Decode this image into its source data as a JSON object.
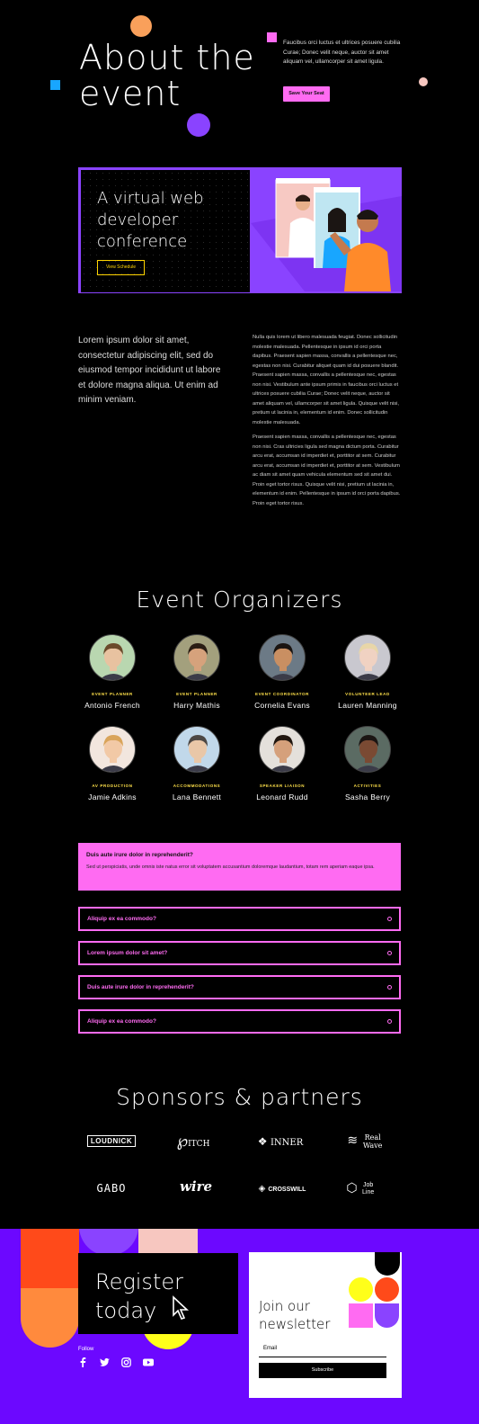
{
  "hero": {
    "title_line1": "About the",
    "title_line2": "event",
    "description": "Faucibus orci luctus et ultrices posuere cubilia Curae; Donec velit neque, auctor sit amet aliquam vel, ullamcorper sit amet ligula.",
    "cta": "Save Your Seat"
  },
  "banner": {
    "title": "A virtual web developer conference",
    "button": "View Schedule"
  },
  "intro": {
    "lead": "Lorem ipsum dolor sit amet, consectetur adipiscing elit, sed do eiusmod tempor incididunt ut labore et dolore magna aliqua. Ut enim ad minim veniam.",
    "para1": "Nulla quis lorem ut libero malesuada feugiat. Donec sollicitudin molestie malesuada. Pellentesque in ipsum id orci porta dapibus. Praesent sapien massa, convallis a pellentesque nec, egestas non nisi. Curabitur aliquet quam id dui posuere blandit. Praesent sapien massa, convallis a pellentesque nec, egestas non nisi. Vestibulum ante ipsum primis in faucibus orci luctus et ultrices posuere cubilia Curae; Donec velit neque, auctor sit amet aliquam vel, ullamcorper sit amet ligula. Quisque velit nisi, pretium ut lacinia in, elementum id enim. Donec sollicitudin molestie malesuada.",
    "para2": "Praesent sapien massa, convallis a pellentesque nec, egestas non nisi. Cras ultricies ligula sed magna dictum porta. Curabitur arcu erat, accumsan id imperdiet et, porttitor at sem. Curabitur arcu erat, accumsan id imperdiet et, porttitor at sem. Vestibulum ac diam sit amet quam vehicula elementum sed sit amet dui. Proin eget tortor risus. Quisque velit nisi, pretium ut lacinia in, elementum id enim. Pellentesque in ipsum id orci porta dapibus. Proin eget tortor risus."
  },
  "organizers": {
    "title": "Event Organizers",
    "people": [
      {
        "role": "EVENT PLANNER",
        "name": "Antonio French",
        "skin": "#e8c2a0",
        "hair": "#6b4a2b",
        "bg": "#b9d7b0"
      },
      {
        "role": "EVENT PLANNER",
        "name": "Harry Mathis",
        "skin": "#d6a27c",
        "hair": "#2a1d14",
        "bg": "#a3a07d"
      },
      {
        "role": "EVENT COORDINATOR",
        "name": "Cornelia Evans",
        "skin": "#c98f62",
        "hair": "#1a1411",
        "bg": "#6c7a86"
      },
      {
        "role": "VOLUNTEER LEAD",
        "name": "Lauren Manning",
        "skin": "#f0d2c2",
        "hair": "#e8d6a8",
        "bg": "#c9c8cf"
      },
      {
        "role": "AV PRODUCTION",
        "name": "Jamie Adkins",
        "skin": "#f2c9a6",
        "hair": "#d9a45a",
        "bg": "#f2e6de"
      },
      {
        "role": "ACCOMMODATIONS",
        "name": "Lana Bennett",
        "skin": "#e9c7a8",
        "hair": "#4c4744",
        "bg": "#c1d8ea"
      },
      {
        "role": "SPEAKER LIAISON",
        "name": "Leonard Rudd",
        "skin": "#d5a07b",
        "hair": "#20160f",
        "bg": "#e4e0db"
      },
      {
        "role": "ACTIVITIES",
        "name": "Sasha Berry",
        "skin": "#7a4a33",
        "hair": "#1b1513",
        "bg": "#5b6b63"
      }
    ]
  },
  "faq": {
    "open": {
      "question": "Duis aute irure dolor in reprehenderit?",
      "answer": "Sed ut perspiciatis, unde omnis iste natus error sit voluptatem accusantium doloremque laudantium, totam rem aperiam eaque ipsa."
    },
    "items": [
      "Aliquip ex ea commodo?",
      "Lorem ipsum dolor sit amet?",
      "Duis aute irure dolor in reprehenderit?",
      "Aliquip ex ea commodo?"
    ]
  },
  "sponsors": {
    "title": "Sponsors & partners",
    "logos": [
      "LOUDNICK",
      "ITCH",
      "INNER",
      "Real Wave",
      "GABO",
      "wire",
      "CROSSWILL",
      "Job Line"
    ]
  },
  "footer": {
    "register_line1": "Register",
    "register_line2": "today",
    "follow": "Follow",
    "newsletter_line1": "Join our",
    "newsletter_line2": "newsletter",
    "email_label": "Email",
    "subscribe": "Subscribe"
  },
  "colors": {
    "pink": "#ff6bf2",
    "purple": "#8a43ff",
    "violet": "#6c08ff",
    "yellow": "#ffe14a",
    "orange": "#ff9f43"
  }
}
